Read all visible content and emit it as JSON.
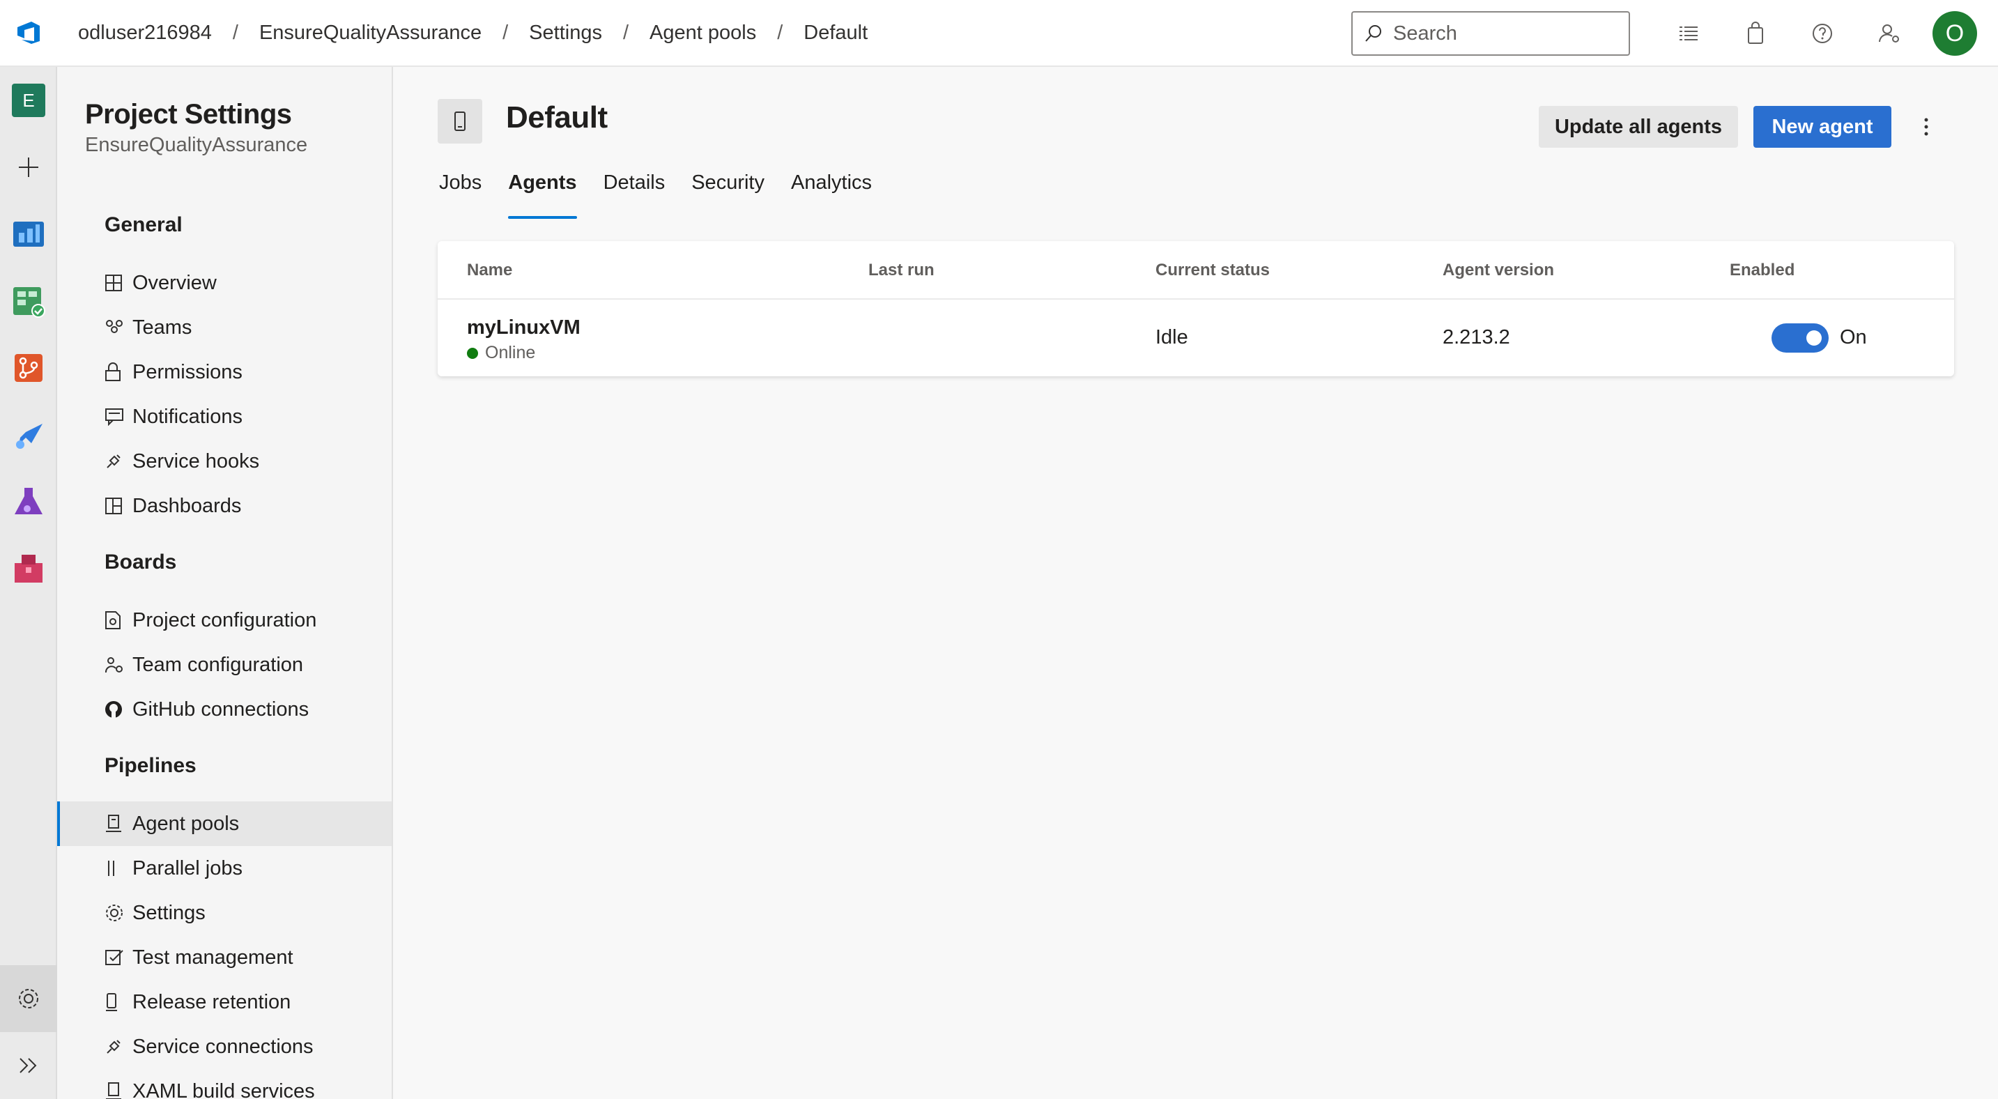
{
  "breadcrumb": {
    "organization": "odluser216984",
    "project": "EnsureQualityAssurance",
    "settings": "Settings",
    "agent_pools": "Agent pools",
    "pool": "Default",
    "separator": "/"
  },
  "topbar": {
    "search_placeholder": "Search",
    "avatar_initial": "O",
    "icons": [
      "list-icon",
      "shopping-bag-icon",
      "help-icon",
      "user-settings-icon"
    ]
  },
  "rail": {
    "project_initial": "E",
    "items": [
      "project-icon",
      "add-icon",
      "overview-icon",
      "boards-icon",
      "repos-icon",
      "pipelines-icon",
      "test-plans-icon",
      "artifacts-icon",
      "settings-icon",
      "expand-icon"
    ]
  },
  "sidebar": {
    "title": "Project Settings",
    "subtitle": "EnsureQualityAssurance",
    "groups": {
      "general": "General",
      "boards": "Boards",
      "pipelines": "Pipelines"
    },
    "general_items": [
      "Overview",
      "Teams",
      "Permissions",
      "Notifications",
      "Service hooks",
      "Dashboards"
    ],
    "boards_items": [
      "Project configuration",
      "Team configuration",
      "GitHub connections"
    ],
    "pipelines_items": [
      "Agent pools",
      "Parallel jobs",
      "Settings",
      "Test management",
      "Release retention",
      "Service connections",
      "XAML build services"
    ],
    "selected_item": "Agent pools"
  },
  "main": {
    "title": "Default",
    "update_button": "Update all agents",
    "new_agent_button": "New agent",
    "tabs": [
      "Jobs",
      "Agents",
      "Details",
      "Security",
      "Analytics"
    ],
    "active_tab": "Agents",
    "table": {
      "headers": [
        "Name",
        "Last run",
        "Current status",
        "Agent version",
        "Enabled"
      ],
      "rows": [
        {
          "name": "myLinuxVM",
          "state": "Online",
          "last_run": "",
          "current_status": "Idle",
          "agent_version": "2.213.2",
          "enabled_label": "On",
          "enabled": true
        }
      ]
    }
  },
  "colors": {
    "accent": "#2a6fd0",
    "online": "#107c10",
    "avatar": "#1e7d32"
  }
}
